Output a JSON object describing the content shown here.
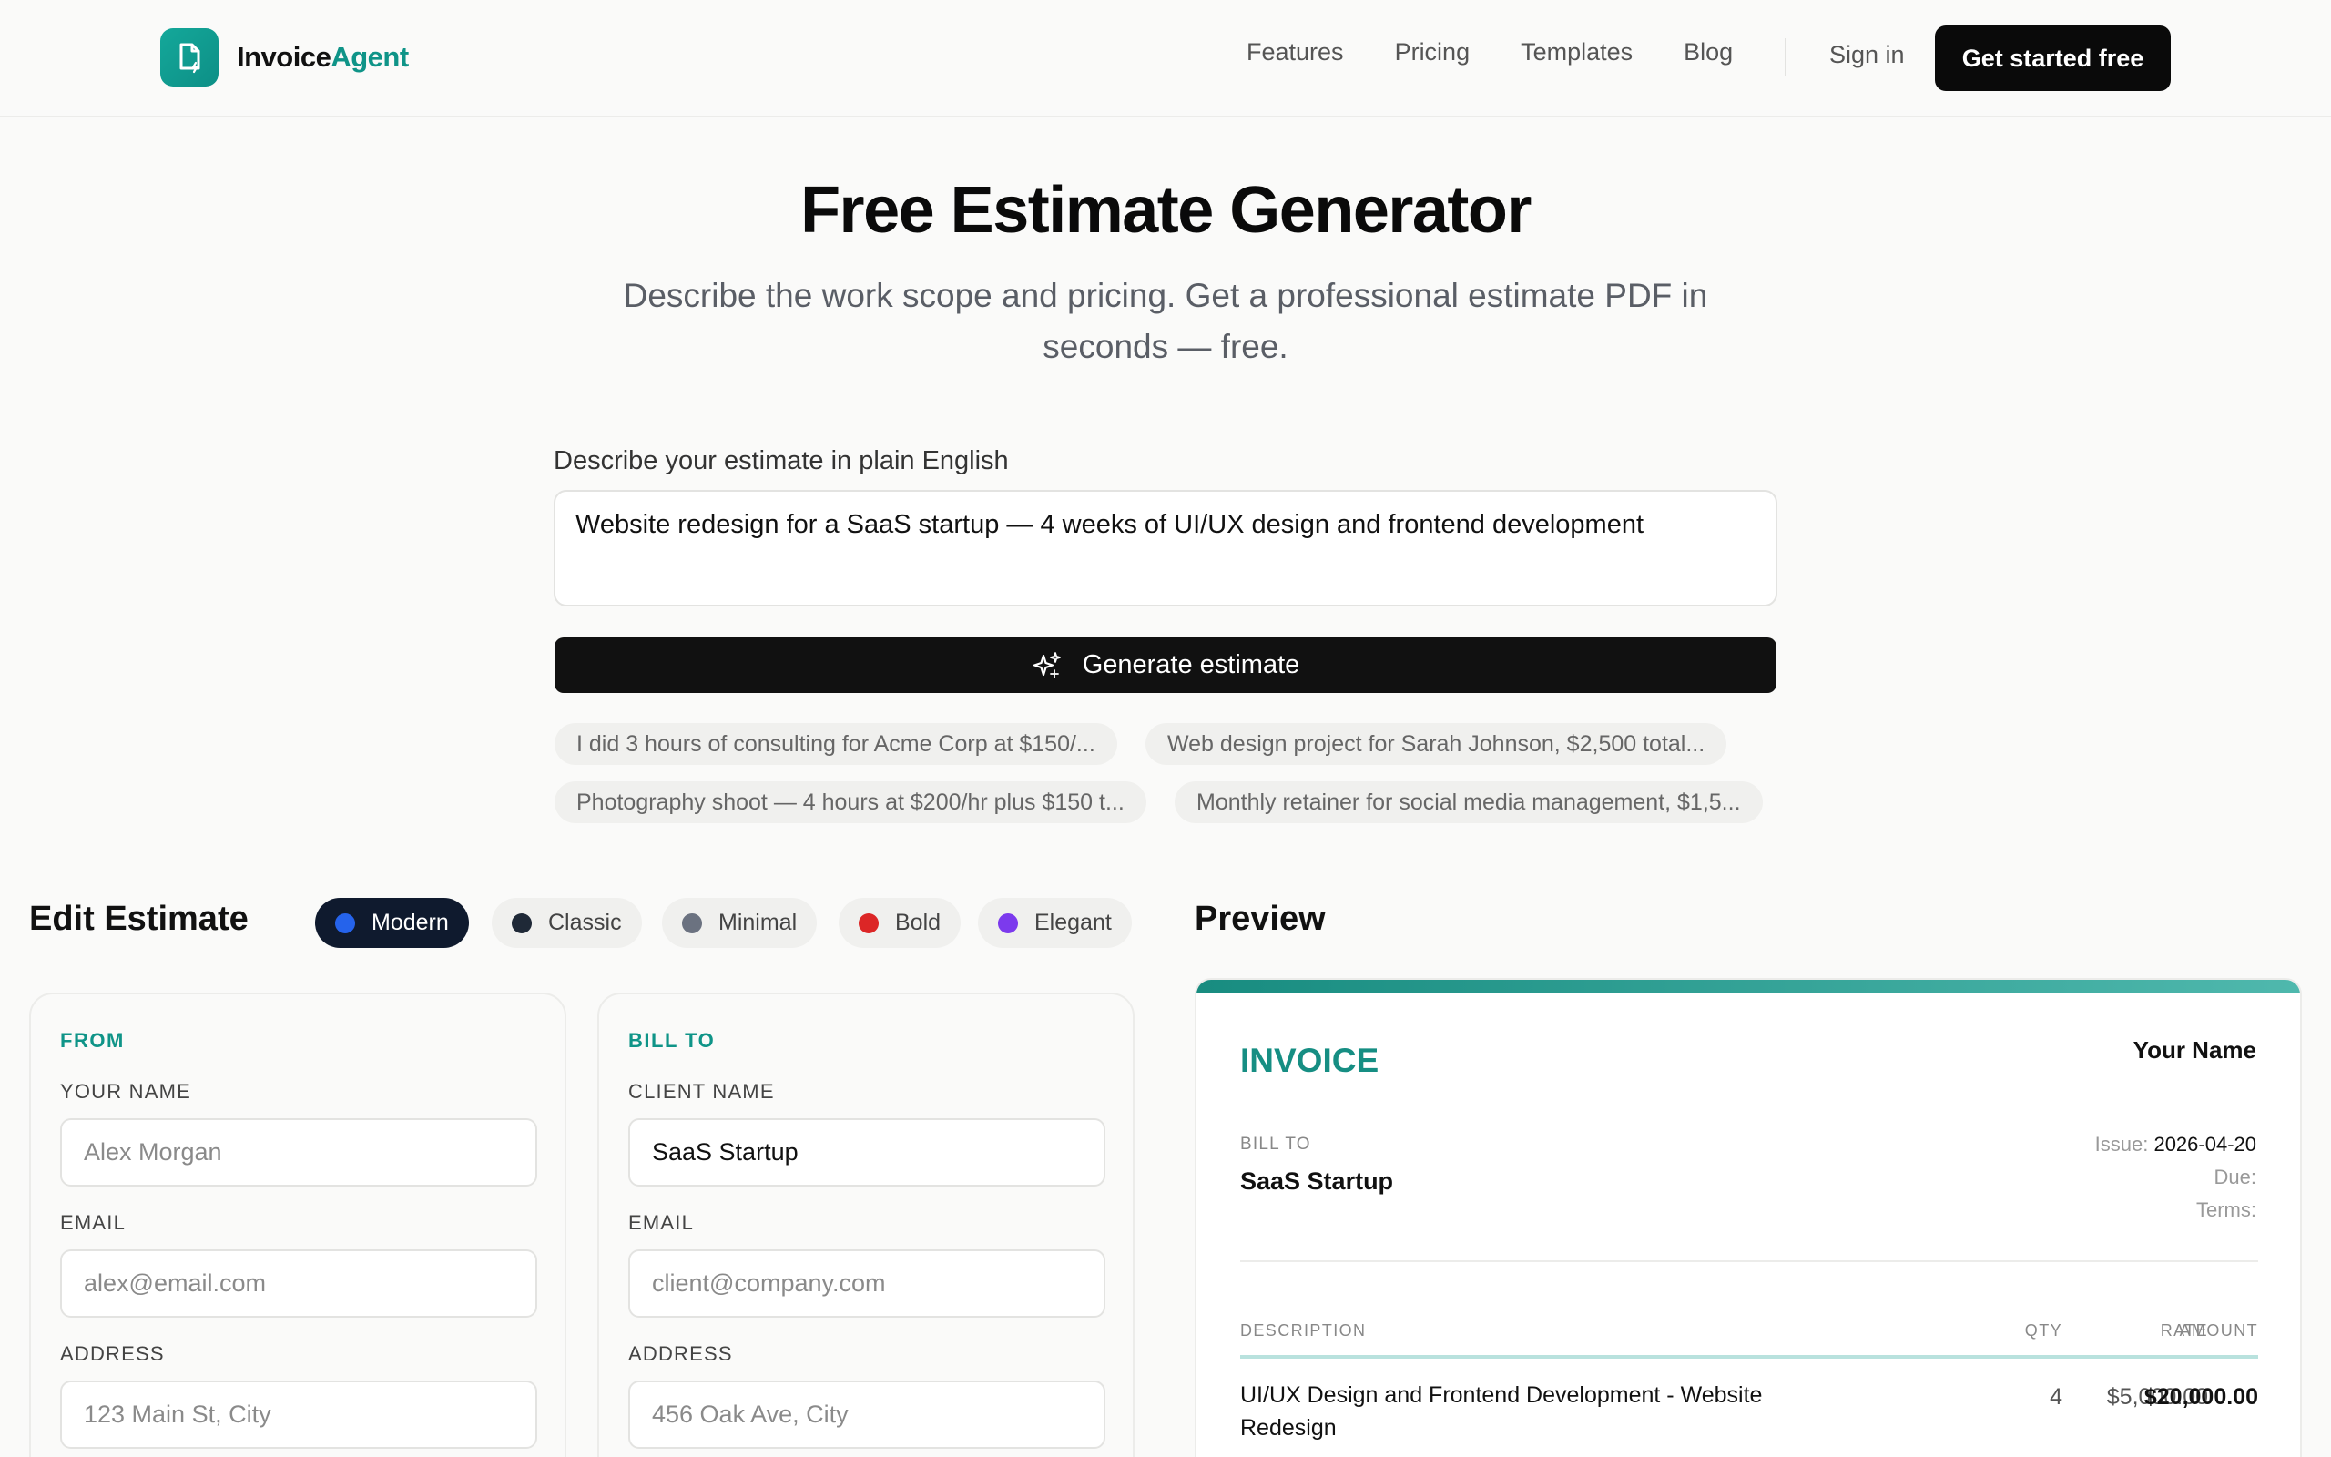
{
  "nav": {
    "brand_main": "Invoice",
    "brand_accent": "Agent",
    "links": [
      "Features",
      "Pricing",
      "Templates",
      "Blog"
    ],
    "signin": "Sign in",
    "cta": "Get started free"
  },
  "hero": {
    "title": "Free Estimate Generator",
    "subtitle": "Describe the work scope and pricing. Get a professional estimate PDF in seconds — free."
  },
  "prompt": {
    "label": "Describe your estimate in plain English",
    "value": "Website redesign for a SaaS startup — 4 weeks of UI/UX design and frontend development",
    "button": "Generate estimate",
    "examples": [
      "I did 3 hours of consulting for Acme Corp at $150/...",
      "Web design project for Sarah Johnson, $2,500 total...",
      "Photography shoot — 4 hours at $200/hr plus $150 t...",
      "Monthly retainer for social media management, $1,5..."
    ]
  },
  "editor": {
    "title": "Edit Estimate",
    "styles": [
      {
        "label": "Modern",
        "color": "#2563eb",
        "active": true
      },
      {
        "label": "Classic",
        "color": "#1f2937",
        "active": false
      },
      {
        "label": "Minimal",
        "color": "#6b7280",
        "active": false
      },
      {
        "label": "Bold",
        "color": "#dc2626",
        "active": false
      },
      {
        "label": "Elegant",
        "color": "#7c3aed",
        "active": false
      }
    ],
    "from": {
      "heading": "FROM",
      "name_label": "YOUR NAME",
      "name_placeholder": "Alex Morgan",
      "email_label": "EMAIL",
      "email_placeholder": "alex@email.com",
      "address_label": "ADDRESS",
      "address_placeholder": "123 Main St, City"
    },
    "bill_to": {
      "heading": "BILL TO",
      "name_label": "CLIENT NAME",
      "name_value": "SaaS Startup",
      "email_label": "EMAIL",
      "email_placeholder": "client@company.com",
      "address_label": "ADDRESS",
      "address_placeholder": "456 Oak Ave, City"
    }
  },
  "preview": {
    "title": "Preview",
    "doc_title": "INVOICE",
    "sender_name": "Your Name",
    "bill_to_label": "BILL TO",
    "client": "SaaS Startup",
    "issue_label": "Issue:",
    "issue_date": "2026-04-20",
    "due_label": "Due:",
    "terms_label": "Terms:",
    "columns": {
      "description": "DESCRIPTION",
      "qty": "QTY",
      "rate": "RATE",
      "amount": "AMOUNT"
    },
    "items": [
      {
        "description_line1": "UI/UX Design and Frontend Development - Website",
        "description_line2": "Redesign",
        "qty": "4",
        "rate": "$5,000.00",
        "amount": "$20,000.00"
      }
    ]
  },
  "colors": {
    "accent": "#0f9488",
    "cta_bg": "#0a0a0a",
    "active_pill": "#0f1a2e"
  }
}
